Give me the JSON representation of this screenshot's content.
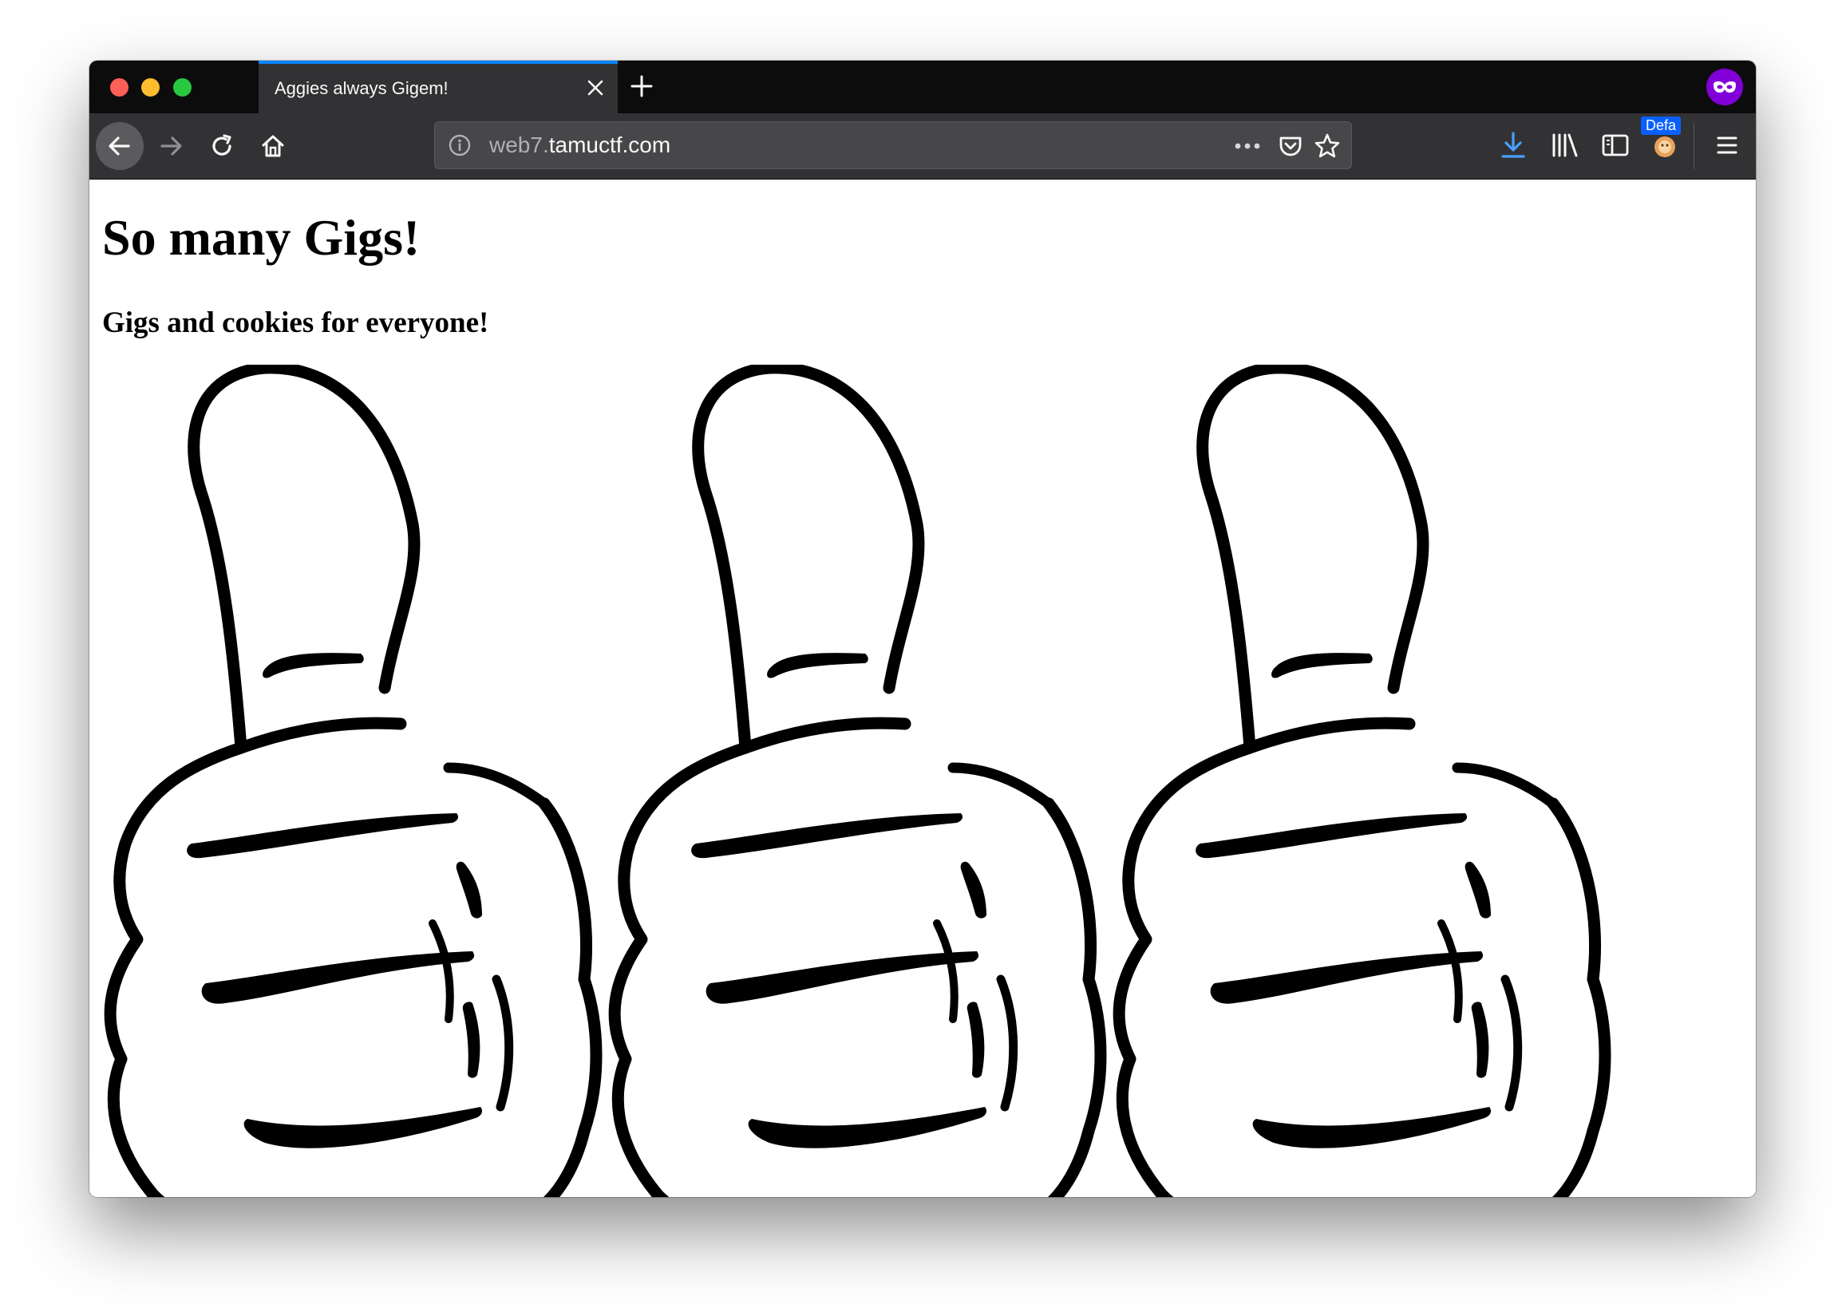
{
  "browser": {
    "tab": {
      "title": "Aggies always Gigem!"
    },
    "urlbar": {
      "url_prefix": "web7.",
      "url_host": "tamuctf.com"
    },
    "badge_label": "Defa",
    "colors": {
      "tab_accent": "#0a84ff",
      "private_browsing": "#8000d7",
      "download_icon": "#45a1ff"
    }
  },
  "page": {
    "heading": "So many Gigs!",
    "subheading": "Gigs and cookies for everyone!",
    "images": [
      {
        "name": "thumbs-up-image"
      },
      {
        "name": "thumbs-up-image"
      },
      {
        "name": "thumbs-up-image"
      }
    ]
  }
}
